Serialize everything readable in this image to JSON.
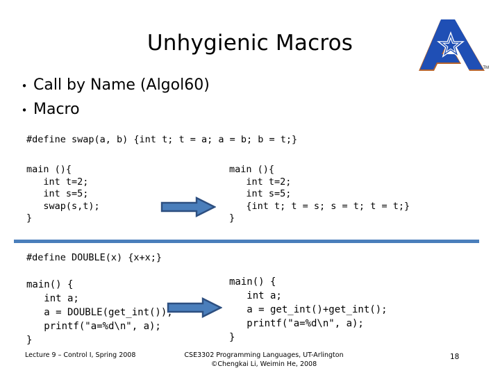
{
  "slide": {
    "title": "Unhygienic Macros",
    "page_number": "18"
  },
  "logo": {
    "name": "uta-a-star-logo",
    "trademark": "TM",
    "blue": "#1f4fb5",
    "outline": "#b5622a"
  },
  "bullets": [
    {
      "marker": "•",
      "text": "Call by Name (Algol60)"
    },
    {
      "marker": "•",
      "text": "Macro"
    }
  ],
  "section_one": {
    "define": "#define swap(a, b) {int t; t = a; a = b; b = t;}",
    "before": "main (){\n   int t=2;\n   int s=5;\n   swap(s,t);\n}",
    "after": "main (){\n   int t=2;\n   int s=5;\n   {int t; t = s; s = t; t = t;}\n}",
    "arrow": "right-arrow"
  },
  "section_two": {
    "define": "#define DOUBLE(x) {x+x;}",
    "before": "main() {\n   int a;\n   a = DOUBLE(get_int());\n   printf(\"a=%d\\n\", a);\n}",
    "after": "main() {\n   int a;\n   a = get_int()+get_int();\n   printf(\"a=%d\\n\", a);\n}",
    "arrow": "right-arrow"
  },
  "divider": {
    "color": "#4a7ebb"
  },
  "arrow_style": {
    "fill": "#4a7ebb",
    "stroke": "#2d4f80"
  },
  "footer": {
    "left": "Lecture 9 – Control I, Spring 2008",
    "center_line1": "CSE3302 Programming Languages, UT-Arlington",
    "center_line2": "©Chengkai Li, Weimin He, 2008"
  }
}
